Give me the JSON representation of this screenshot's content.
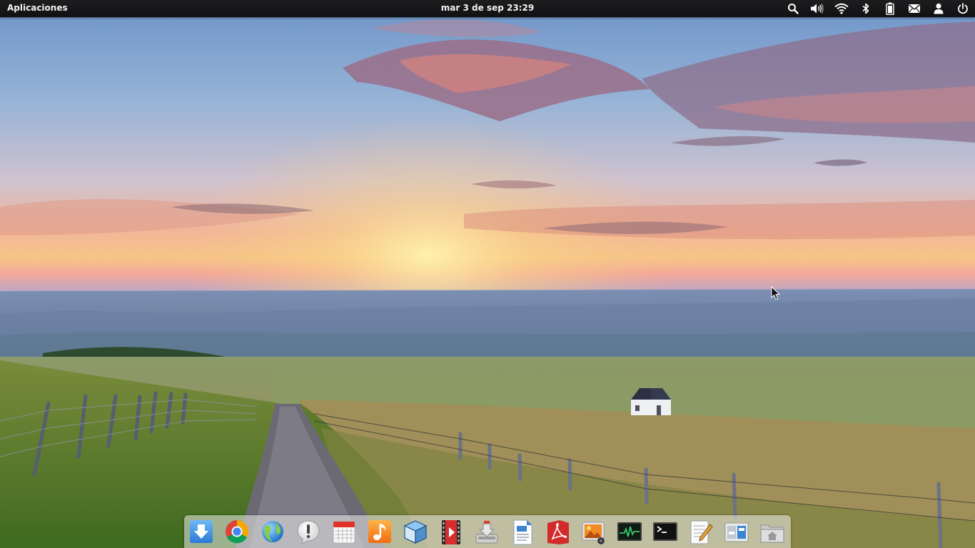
{
  "panel": {
    "apps_label": "Aplicaciones",
    "clock_text": "mar  3 de sep 23:29",
    "indicators": [
      "search-icon",
      "volume-icon",
      "wifi-icon",
      "bluetooth-icon",
      "battery-icon",
      "mail-icon",
      "user-icon",
      "power-icon"
    ]
  },
  "dock": {
    "items": [
      {
        "name": "downloads",
        "icon": "download-arrow-icon"
      },
      {
        "name": "chrome",
        "icon": "chrome-icon"
      },
      {
        "name": "web-browser",
        "icon": "globe-icon"
      },
      {
        "name": "notifications",
        "icon": "exclamation-bubble-icon"
      },
      {
        "name": "calendar",
        "icon": "calendar-icon"
      },
      {
        "name": "music",
        "icon": "music-note-icon"
      },
      {
        "name": "virtualbox",
        "icon": "cube-icon"
      },
      {
        "name": "video-player",
        "icon": "film-play-icon"
      },
      {
        "name": "installer",
        "icon": "install-tray-icon"
      },
      {
        "name": "document-writer",
        "icon": "writer-doc-icon"
      },
      {
        "name": "pdf-reader",
        "icon": "pdf-icon"
      },
      {
        "name": "photo-viewer",
        "icon": "photos-icon"
      },
      {
        "name": "system-monitor",
        "icon": "monitor-pulse-icon"
      },
      {
        "name": "terminal",
        "icon": "terminal-icon"
      },
      {
        "name": "text-editor",
        "icon": "notepad-pencil-icon"
      },
      {
        "name": "settings",
        "icon": "switchboard-icon"
      },
      {
        "name": "files",
        "icon": "home-folder-icon"
      }
    ]
  },
  "colors": {
    "panel_bg": "#151517",
    "panel_text": "#f2f2f2",
    "dock_bg": "#ebebeb"
  }
}
